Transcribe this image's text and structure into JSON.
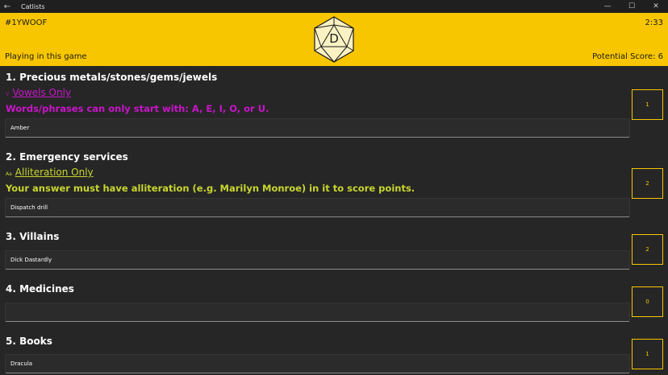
{
  "window": {
    "title": "Catlists",
    "back_glyph": "←",
    "minimize_glyph": "—",
    "maximize_glyph": "☐",
    "close_glyph": "✕"
  },
  "header": {
    "game_code": "#1YWOOF",
    "timer": "2:33",
    "playing_label": "Playing in this game",
    "potential_score": "Potential Score: 6",
    "die_letter": "D",
    "die_icon": "d20-icon"
  },
  "categories": [
    {
      "title": "1. Precious metals/stones/gems/jewels",
      "rule_icon": "𝕍",
      "rule_name": "Vowels Only",
      "rule_description": "Words/phrases can only start with: A, E, I, O, or U.",
      "answer": "Amber",
      "score": "1"
    },
    {
      "title": "2. Emergency services",
      "rule_icon": "Aa",
      "rule_name": "Alliteration Only",
      "rule_description": "Your answer must have alliteration (e.g. Marilyn Monroe) in it to score points.",
      "answer": "Dispatch drill",
      "score": "2"
    },
    {
      "title": "3. Villains",
      "answer": "Dick Dastardly",
      "score": "2"
    },
    {
      "title": "4. Medicines",
      "answer": "",
      "score": "0"
    },
    {
      "title": "5. Books",
      "answer": "Dracula",
      "score": "1"
    }
  ],
  "colors": {
    "accent": "#f8c600",
    "background": "#262626",
    "vowels_rule": "#c914c9",
    "alliteration_rule": "#c8d62e"
  }
}
